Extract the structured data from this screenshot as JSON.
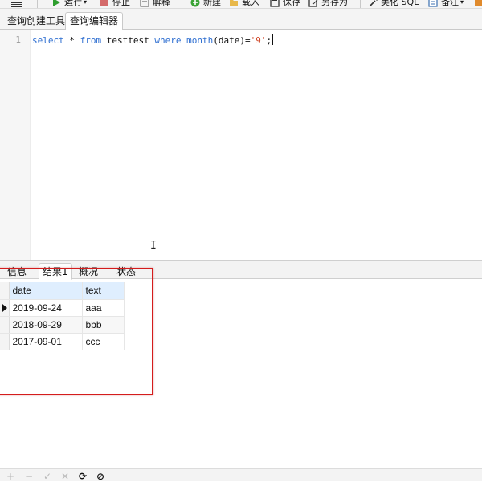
{
  "toolbar": {
    "run_label": "运行",
    "stop_label": "停止",
    "explain_label": "解释",
    "new_label": "新建",
    "load_label": "载入",
    "save_label": "保存",
    "save_as_label": "另存为",
    "beautify_label": "美化 SQL",
    "comment_label": "备注",
    "icons": {
      "menu": "menu-icon",
      "run": "play-icon",
      "stop": "stop-icon",
      "explain": "explain-icon",
      "new": "plus-circle-icon",
      "load": "folder-icon",
      "save": "floppy-icon",
      "save_as": "save-as-icon",
      "beautify": "magic-wand-icon",
      "comment": "note-icon"
    },
    "colors": {
      "run": "#2e9e2e",
      "stop": "#c44040",
      "new": "#3aa335"
    }
  },
  "tabs": [
    {
      "label": "查询创建工具"
    },
    {
      "label": "查询编辑器",
      "active": true
    }
  ],
  "editor": {
    "line_number": "1",
    "tokens": {
      "kw_select": "select",
      "star": " * ",
      "kw_from": "from",
      "table": " testtest ",
      "kw_where": "where",
      "sp": " ",
      "kw_month": "month",
      "paren": "(date)=",
      "str": "'9'",
      "semi": ";"
    },
    "cursor_glyph": "I"
  },
  "result_tabs": [
    {
      "label": "信息"
    },
    {
      "label": "结果1",
      "active": true
    },
    {
      "label": "概况"
    },
    {
      "label": "状态"
    }
  ],
  "grid": {
    "columns": [
      "date",
      "text"
    ],
    "rows": [
      [
        "2019-09-24",
        "aaa"
      ],
      [
        "2018-09-29",
        "bbb"
      ],
      [
        "2017-09-01",
        "ccc"
      ]
    ],
    "current_row": 0
  },
  "bottom_bar": {
    "add": "+",
    "remove": "−",
    "apply": "✓",
    "cancel": "✕",
    "refresh": "⟳",
    "stop": "⊘"
  }
}
